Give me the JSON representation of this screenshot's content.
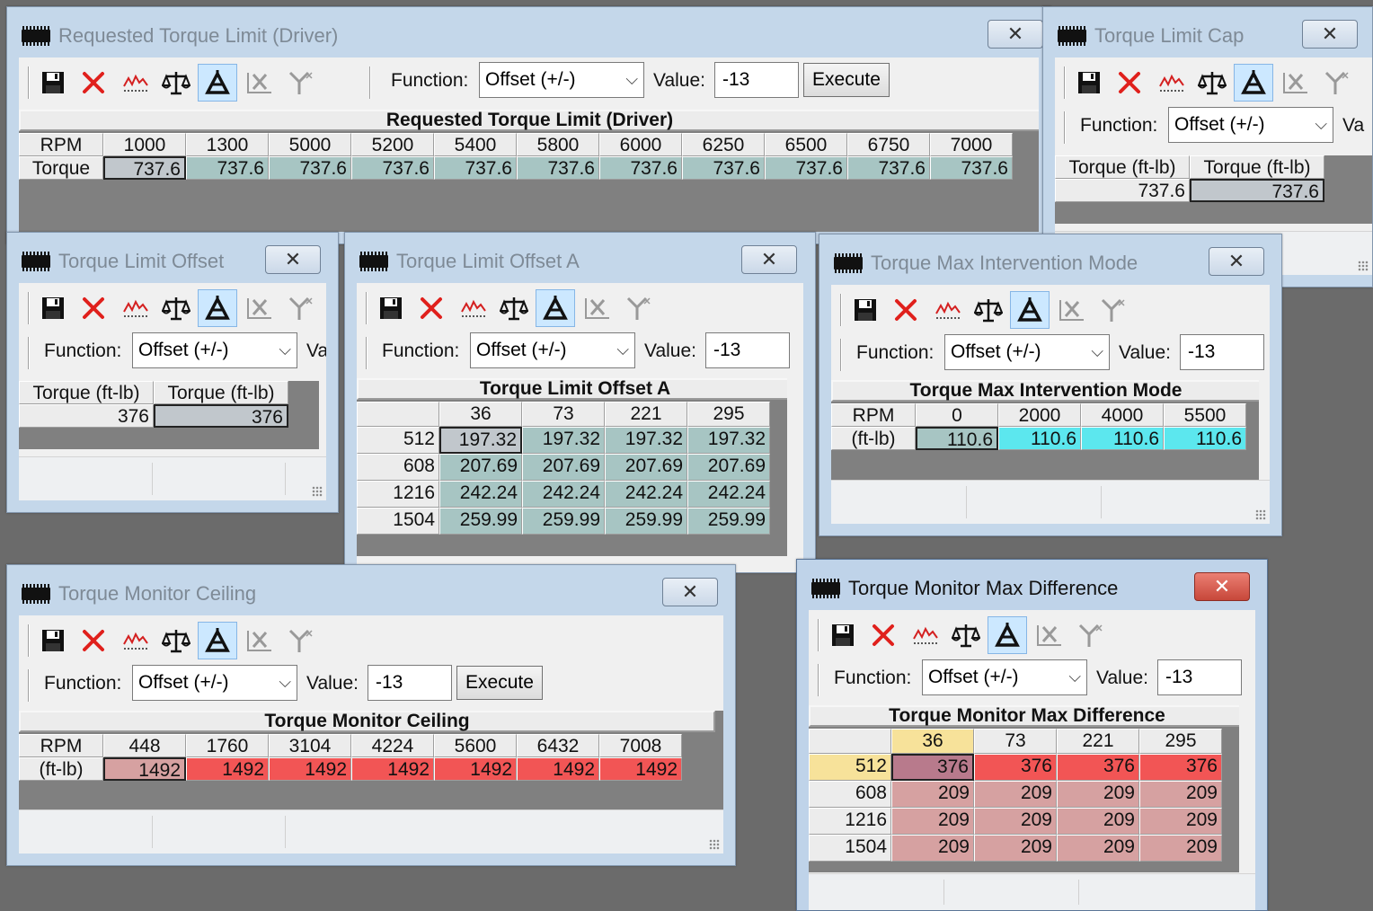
{
  "common": {
    "function_label": "Function:",
    "function_value": "Offset (+/-)",
    "value_label": "Value:",
    "value_label_cut": "Va",
    "value": "-13",
    "execute_label": "Execute",
    "close_glyph": "✕",
    "combo_arrow": "⌵"
  },
  "icons": [
    "save-icon",
    "delete-icon",
    "graph-icon",
    "scale-icon",
    "triangle-tool-icon",
    "x-axis-icon",
    "y-axis-icon"
  ],
  "colors": {
    "teal": "#a7c5c3",
    "cyan": "#5ce7ee",
    "pink": "#d6a1a1",
    "red": "#f25555",
    "mauve": "#b87a8c",
    "yellow": "#f7e29a",
    "gray_cell": "#c1c7cc"
  },
  "windows": {
    "requested": {
      "title": "Requested Torque Limit (Driver)",
      "grid_title": "Requested Torque Limit (Driver)",
      "corner": "RPM",
      "row_label": "Torque",
      "cols": [
        "1000",
        "1300",
        "5000",
        "5200",
        "5400",
        "5800",
        "6000",
        "6250",
        "6500",
        "6750",
        "7000"
      ],
      "values": [
        "737.6",
        "737.6",
        "737.6",
        "737.6",
        "737.6",
        "737.6",
        "737.6",
        "737.6",
        "737.6",
        "737.6",
        "737.6"
      ]
    },
    "cap": {
      "title": "Torque Limit Cap",
      "headers": [
        "Torque (ft-lb)",
        "Torque (ft-lb)"
      ],
      "values": [
        "737.6",
        "737.6"
      ]
    },
    "offset": {
      "title": "Torque Limit Offset",
      "headers": [
        "Torque (ft-lb)",
        "Torque (ft-lb)"
      ],
      "values": [
        "376",
        "376"
      ]
    },
    "offset_a": {
      "title": "Torque Limit Offset A",
      "grid_title": "Torque Limit Offset A",
      "cols": [
        "36",
        "73",
        "221",
        "295"
      ],
      "rows": [
        {
          "label": "512",
          "values": [
            "197.32",
            "197.32",
            "197.32",
            "197.32"
          ]
        },
        {
          "label": "608",
          "values": [
            "207.69",
            "207.69",
            "207.69",
            "207.69"
          ]
        },
        {
          "label": "1216",
          "values": [
            "242.24",
            "242.24",
            "242.24",
            "242.24"
          ]
        },
        {
          "label": "1504",
          "values": [
            "259.99",
            "259.99",
            "259.99",
            "259.99"
          ]
        }
      ]
    },
    "intervention": {
      "title": "Torque Max Intervention Mode",
      "grid_title": "Torque Max Intervention Mode",
      "corner": "RPM",
      "row_label": "(ft-lb)",
      "cols": [
        "0",
        "2000",
        "4000",
        "5500"
      ],
      "values": [
        "110.6",
        "110.6",
        "110.6",
        "110.6"
      ]
    },
    "ceiling": {
      "title": "Torque Monitor Ceiling",
      "grid_title": "Torque Monitor Ceiling",
      "corner": "RPM",
      "row_label": "(ft-lb)",
      "cols": [
        "448",
        "1760",
        "3104",
        "4224",
        "5600",
        "6432",
        "7008"
      ],
      "values": [
        "1492",
        "1492",
        "1492",
        "1492",
        "1492",
        "1492",
        "1492"
      ]
    },
    "maxdiff": {
      "title": "Torque Monitor Max Difference",
      "grid_title": "Torque Monitor Max Difference",
      "cols": [
        "36",
        "73",
        "221",
        "295"
      ],
      "rows": [
        {
          "label": "512",
          "values": [
            "376",
            "376",
            "376",
            "376"
          ]
        },
        {
          "label": "608",
          "values": [
            "209",
            "209",
            "209",
            "209"
          ]
        },
        {
          "label": "1216",
          "values": [
            "209",
            "209",
            "209",
            "209"
          ]
        },
        {
          "label": "1504",
          "values": [
            "209",
            "209",
            "209",
            "209"
          ]
        }
      ]
    }
  }
}
